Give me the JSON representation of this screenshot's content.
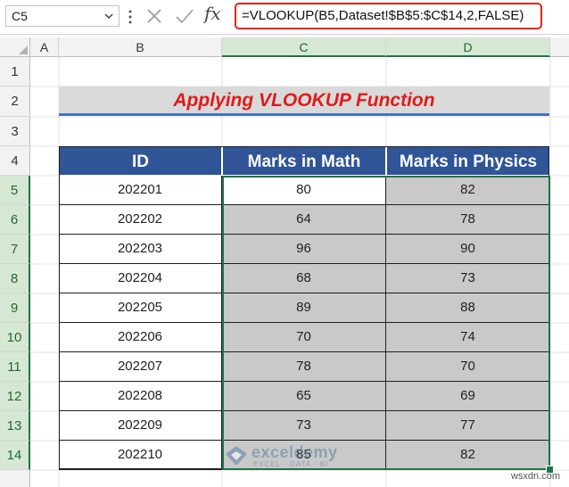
{
  "formula_bar": {
    "name_box": "C5",
    "fx_label": "fx",
    "formula": "=VLOOKUP(B5,Dataset!$B$5:$C$14,2,FALSE)"
  },
  "columns": [
    "A",
    "B",
    "C",
    "D"
  ],
  "rows": [
    "1",
    "2",
    "3",
    "4",
    "5",
    "6",
    "7",
    "8",
    "9",
    "10",
    "11",
    "12",
    "13",
    "14"
  ],
  "title": "Applying VLOOKUP Function",
  "table": {
    "headers": [
      "ID",
      "Marks in Math",
      "Marks in Physics"
    ],
    "rows": [
      [
        "202201",
        "80",
        "82"
      ],
      [
        "202202",
        "64",
        "78"
      ],
      [
        "202203",
        "96",
        "90"
      ],
      [
        "202204",
        "68",
        "73"
      ],
      [
        "202205",
        "89",
        "88"
      ],
      [
        "202206",
        "70",
        "74"
      ],
      [
        "202207",
        "78",
        "70"
      ],
      [
        "202208",
        "65",
        "69"
      ],
      [
        "202209",
        "73",
        "77"
      ],
      [
        "202210",
        "85",
        "82"
      ]
    ]
  },
  "watermark": {
    "name": "exceldemy",
    "tagline": "EXCEL · DATA · BI"
  },
  "credit": "wsxdn.com",
  "colors": {
    "header_bg": "#2f5597",
    "title_text": "#e01b1b",
    "selection": "#217346",
    "cell_gray": "#c9c9c9"
  }
}
